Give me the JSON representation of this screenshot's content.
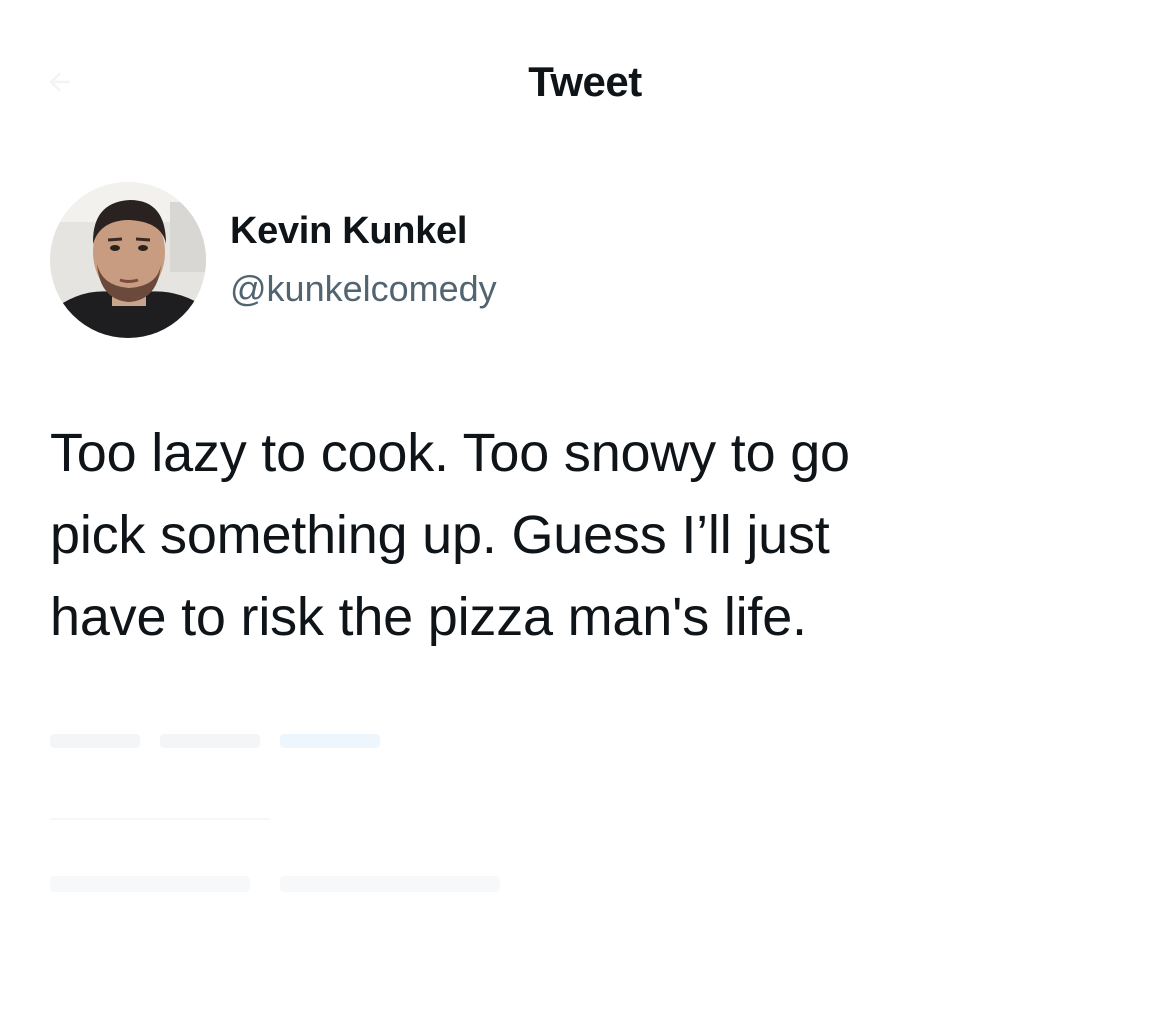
{
  "header": {
    "title": "Tweet",
    "back_icon": "arrow-left-icon"
  },
  "author": {
    "display_name": "Kevin Kunkel",
    "handle": "@kunkelcomedy",
    "avatar_icon": "profile-photo"
  },
  "tweet": {
    "text_lines": [
      "Too lazy to cook. Too snowy to go",
      "pick something up. Guess I’ll just",
      "have to risk the pizza man's life."
    ]
  },
  "colors": {
    "text_primary": "#0f1419",
    "text_secondary": "#536471",
    "background": "#ffffff"
  }
}
